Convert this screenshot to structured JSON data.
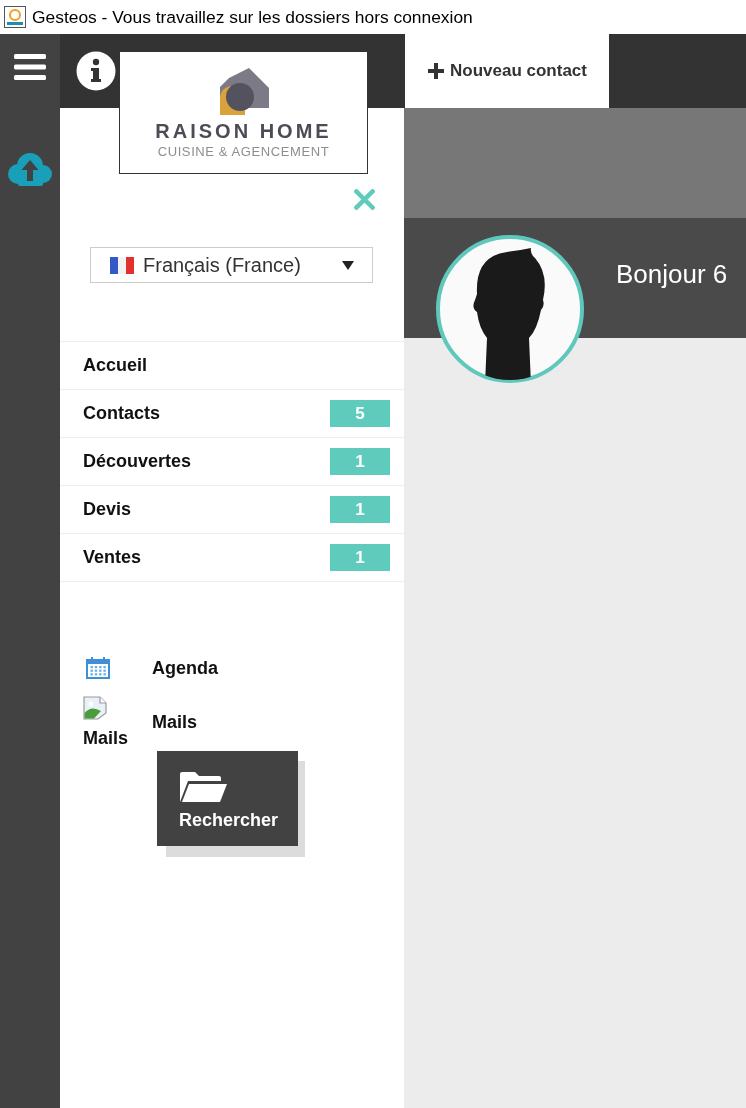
{
  "window": {
    "title": "Gesteos - Vous travaillez sur les dossiers hors connexion"
  },
  "logo": {
    "name": "RAISON HOME",
    "tagline": "CUISINE & AGENCEMENT"
  },
  "language_select": {
    "value": "Français (France)"
  },
  "nav": [
    {
      "label": "Accueil"
    },
    {
      "label": "Contacts",
      "badge": "5"
    },
    {
      "label": "Découvertes",
      "badge": "1"
    },
    {
      "label": "Devis",
      "badge": "1"
    },
    {
      "label": "Ventes",
      "badge": "1"
    }
  ],
  "tools": [
    {
      "kind": "calendar",
      "label": "Agenda"
    },
    {
      "kind": "broken_image",
      "alt": "Mails",
      "label": "Mails"
    }
  ],
  "search_tile": {
    "label": "Rechercher"
  },
  "tabs": [
    {
      "label": "Nouveau contact",
      "selected": true
    }
  ],
  "greeting": {
    "text": "Bonjour 6"
  }
}
